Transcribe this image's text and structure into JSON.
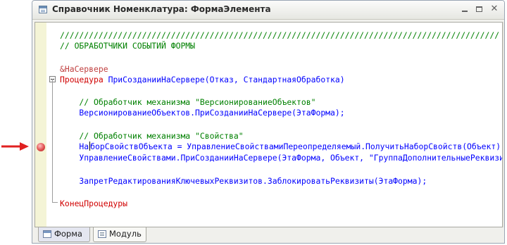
{
  "window": {
    "title": "Справочник Номенклатура: ФормаЭлемента"
  },
  "title_buttons": {
    "minimize": "minimize",
    "maximize": "maximize",
    "close": "✕"
  },
  "code": [
    {
      "text": "///////////////////////////////////////////////////////////////////////////////////////////",
      "class": "c"
    },
    {
      "text": "// ОБРАБОТЧИКИ СОБЫТИЙ ФОРМЫ",
      "class": "c"
    },
    {
      "text": "&НаСервере",
      "class": "p"
    },
    {
      "text": "Процедура",
      "class": "k"
    },
    {
      "text": " ПриСозданииНаСервере(Отказ, СтандартнаяОбработка)",
      "class": "t"
    },
    {
      "text": "    // Обработчик механизма \"ВерсионированиеОбъектов\"",
      "class": "c"
    },
    {
      "text": "    ВерсионированиеОбъектов.ПриСозданииНаСервере(ЭтаФорма);",
      "class": "t"
    },
    {
      "text": "    // Обработчик механизма \"Свойства\"",
      "class": "c"
    },
    {
      "text": "    На",
      "class": "t"
    },
    {
      "text": "борСвойствОбъекта = УправлениеСвойствамиПереопределяемый.ПолучитьНаборСвойств(Объект);",
      "class": "t"
    },
    {
      "text": "    УправлениеСвойствами.ПриСозданииНаСервере(ЭтаФорма, Объект, \"ГруппаДополнительныеРеквизиты\");",
      "class": "t"
    },
    {
      "text": "    ЗапретРедактированияКлючевыхРеквизитов.ЗаблокироватьРеквизиты(ЭтаФорма);",
      "class": "t"
    },
    {
      "text": "КонецПроцедуры",
      "class": "k"
    }
  ],
  "tabs": {
    "form": "Форма",
    "module": "Модуль"
  },
  "colors": {
    "comment": "#008000",
    "keyword": "#d00000",
    "preprocessor": "#c04040",
    "text": "#0000ff",
    "gutter": "#f4f4d6",
    "breakpoint": "#e05050",
    "arrow": "#e02020"
  }
}
